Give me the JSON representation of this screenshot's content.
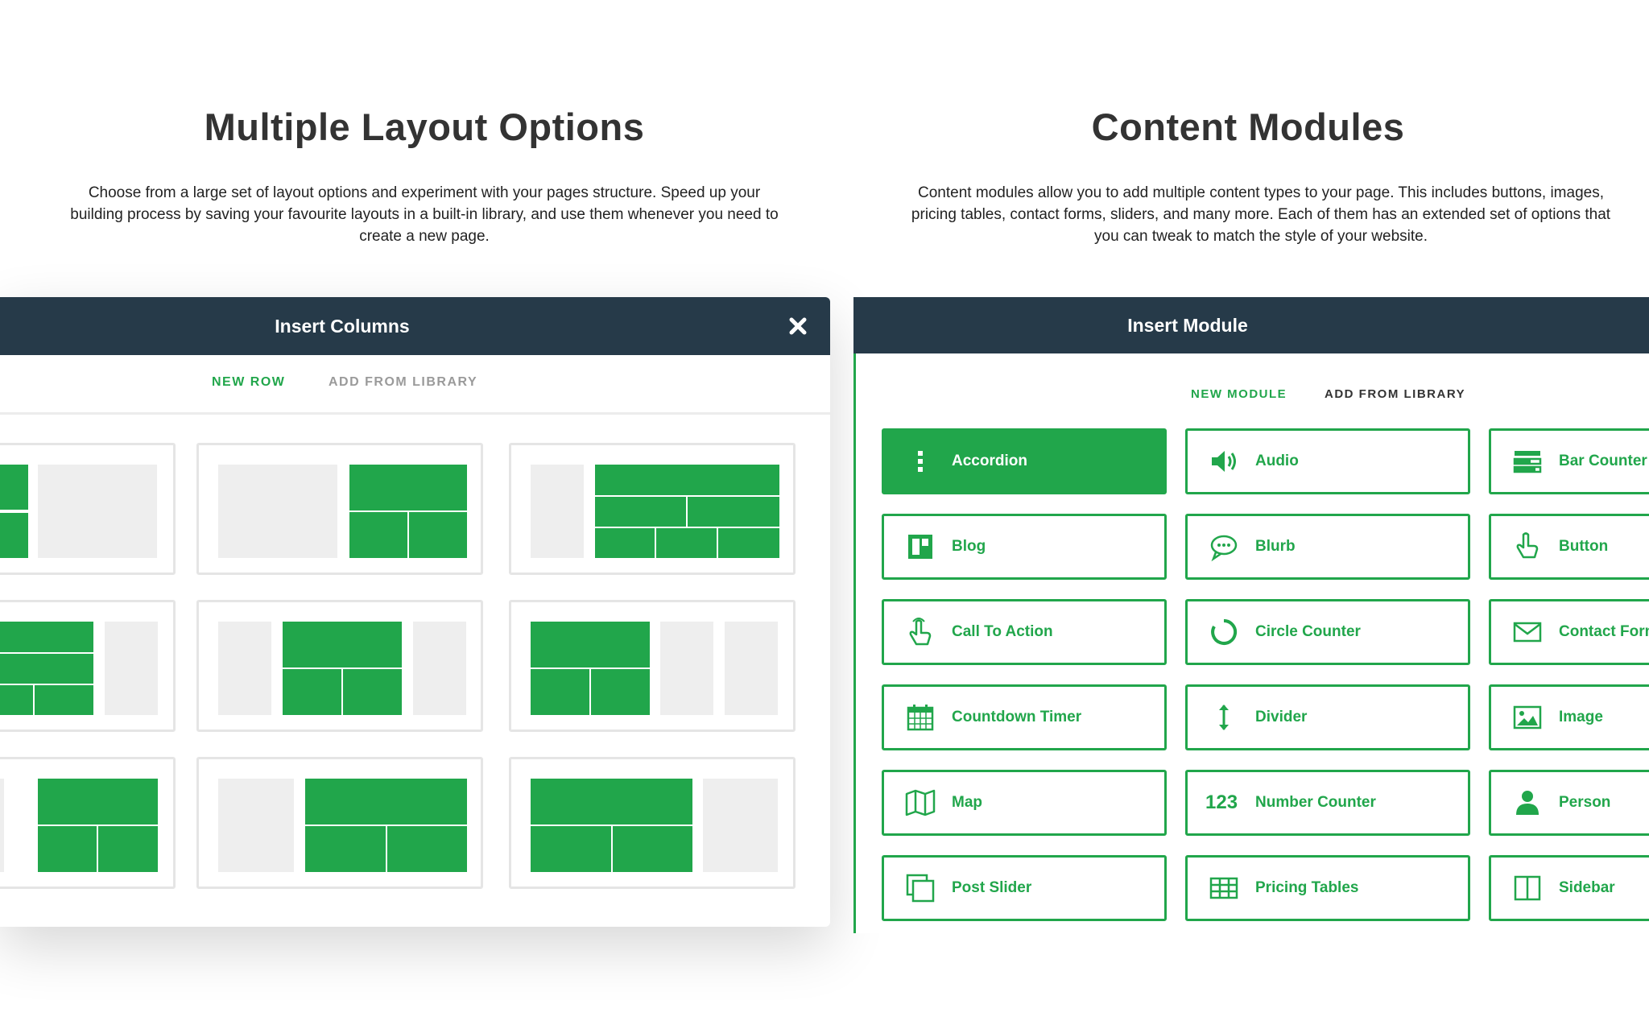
{
  "left_section": {
    "heading": "Multiple Layout Options",
    "description": "Choose from a large set of layout options and experiment with your pages structure. Speed up your building process by saving your favourite layouts in a built-in library, and use them whenever you need to create a new page."
  },
  "right_section": {
    "heading": "Content Modules",
    "description": "Content modules allow you to add multiple content types to your page. This includes buttons, images, pricing tables, contact forms, sliders, and many more. Each of them has an extended set of options that you can tweak to match the style of your website."
  },
  "insert_columns": {
    "title": "Insert Columns",
    "close_icon": "close-icon",
    "tabs": [
      {
        "label": "NEW ROW",
        "active": true
      },
      {
        "label": "ADD FROM LIBRARY",
        "active": false
      }
    ]
  },
  "insert_module": {
    "title": "Insert Module",
    "tabs": [
      {
        "label": "NEW MODULE",
        "active": true
      },
      {
        "label": "ADD FROM LIBRARY",
        "active": false
      }
    ],
    "modules": [
      {
        "label": "Accordion",
        "icon": "accordion-icon",
        "active": true
      },
      {
        "label": "Audio",
        "icon": "audio-icon",
        "active": false
      },
      {
        "label": "Bar Counter",
        "icon": "bar-counter-icon",
        "active": false
      },
      {
        "label": "Blog",
        "icon": "blog-icon",
        "active": false
      },
      {
        "label": "Blurb",
        "icon": "blurb-icon",
        "active": false
      },
      {
        "label": "Button",
        "icon": "button-icon",
        "active": false
      },
      {
        "label": "Call To Action",
        "icon": "call-to-action-icon",
        "active": false
      },
      {
        "label": "Circle Counter",
        "icon": "circle-counter-icon",
        "active": false
      },
      {
        "label": "Contact Form",
        "icon": "contact-form-icon",
        "active": false
      },
      {
        "label": "Countdown Timer",
        "icon": "countdown-timer-icon",
        "active": false
      },
      {
        "label": "Divider",
        "icon": "divider-icon",
        "active": false
      },
      {
        "label": "Image",
        "icon": "image-icon",
        "active": false
      },
      {
        "label": "Map",
        "icon": "map-icon",
        "active": false
      },
      {
        "label": "Number Counter",
        "icon": "number-counter-icon",
        "icon_text": "123",
        "active": false
      },
      {
        "label": "Person",
        "icon": "person-icon",
        "active": false
      },
      {
        "label": "Post Slider",
        "icon": "post-slider-icon",
        "active": false
      },
      {
        "label": "Pricing Tables",
        "icon": "pricing-tables-icon",
        "active": false
      },
      {
        "label": "Sidebar",
        "icon": "sidebar-icon",
        "active": false
      }
    ]
  },
  "colors": {
    "brand_green": "#21a64b",
    "header_navy": "#263a49",
    "placeholder_grey": "#eeeeee",
    "card_border": "#e5e5e5"
  }
}
